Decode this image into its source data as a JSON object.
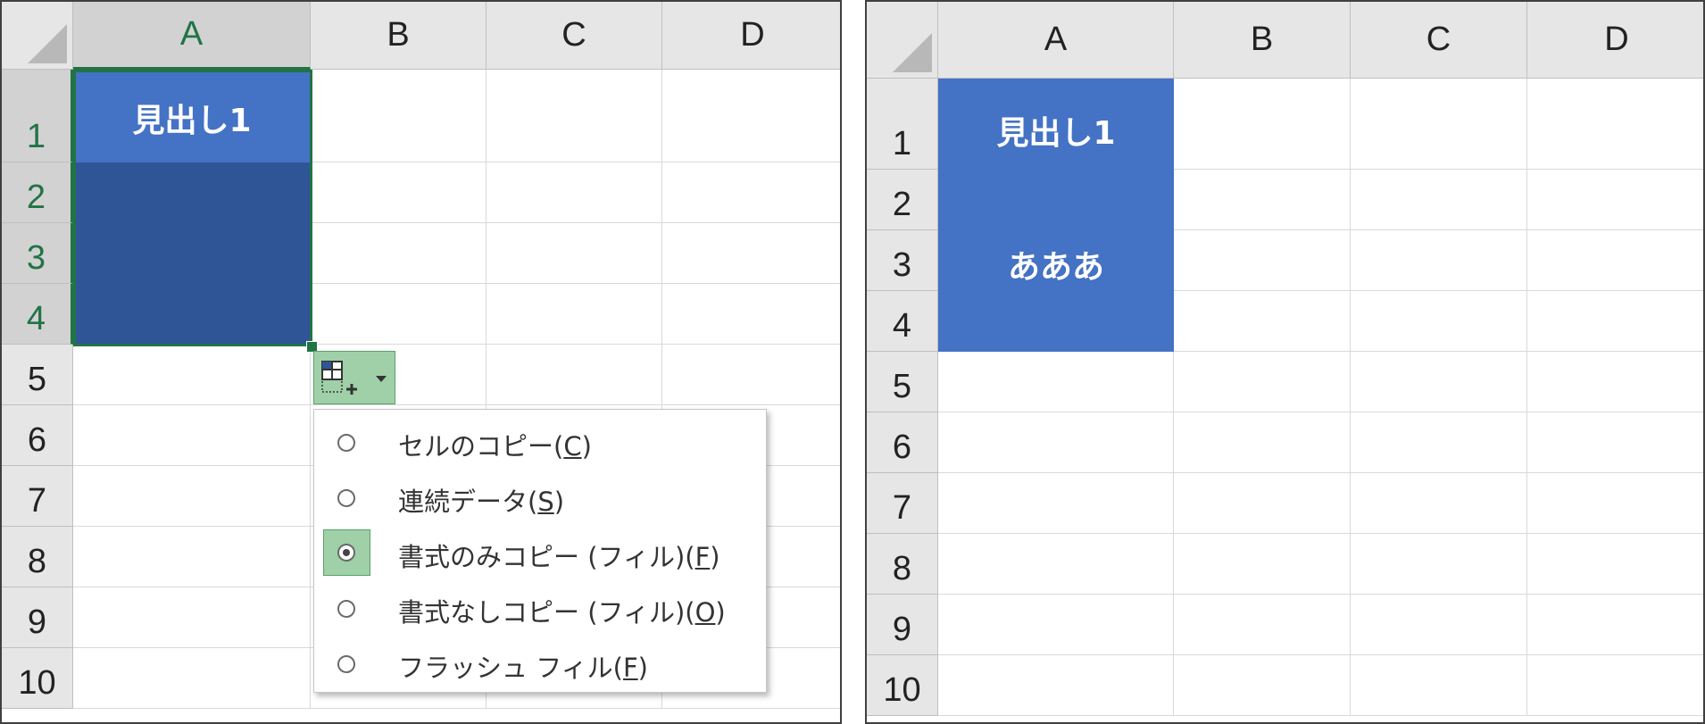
{
  "left_panel": {
    "column_headers": [
      "A",
      "B",
      "C",
      "D"
    ],
    "row_headers": [
      "1",
      "2",
      "3",
      "4",
      "5",
      "6",
      "7",
      "8",
      "9",
      "10"
    ],
    "selected_range": "A1:A4",
    "cells": {
      "A1": "見出し1"
    },
    "autofill_menu": {
      "items": [
        {
          "label": "セルのコピー(",
          "mnemonic": "C",
          "suffix": ")",
          "checked": false
        },
        {
          "label": "連続データ(",
          "mnemonic": "S",
          "suffix": ")",
          "checked": false
        },
        {
          "label": "書式のみコピー (フィル)(",
          "mnemonic": "F",
          "suffix": ")",
          "checked": true
        },
        {
          "label": "書式なしコピー (フィル)(",
          "mnemonic": "O",
          "suffix": ")",
          "checked": false
        },
        {
          "label": "フラッシュ フィル(",
          "mnemonic": "F",
          "suffix": ")",
          "checked": false
        }
      ]
    }
  },
  "right_panel": {
    "column_headers": [
      "A",
      "B",
      "C",
      "D"
    ],
    "row_headers": [
      "1",
      "2",
      "3",
      "4",
      "5",
      "6",
      "7",
      "8",
      "9",
      "10"
    ],
    "cells": {
      "A1": "見出し1",
      "A3": "あああ"
    }
  },
  "colors": {
    "header_blue": "#4472c4",
    "selected_dark_blue": "#2f5597",
    "selection_green": "#217346",
    "menu_highlight": "#9fd0a7"
  },
  "icons": [
    "autofill-options-icon",
    "chevron-down-icon",
    "corner-select-all-icon"
  ]
}
